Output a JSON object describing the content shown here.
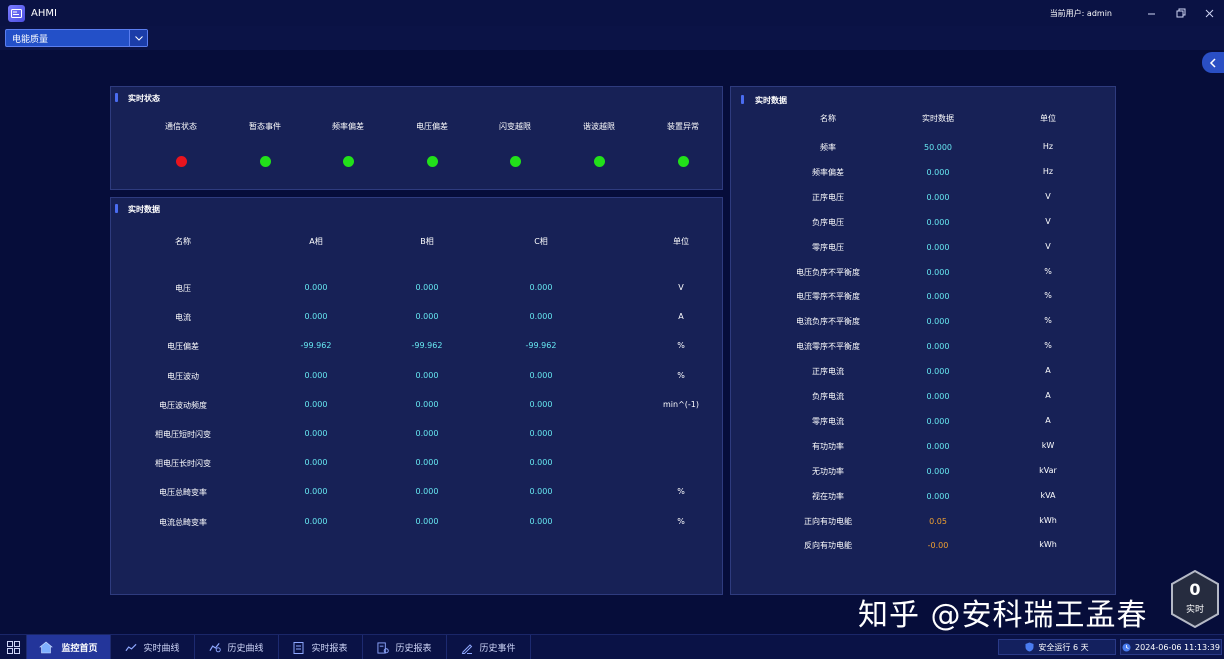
{
  "window": {
    "title": "AHMI",
    "user_label": "当前用户:  admin"
  },
  "toolbar": {
    "module_select": "电能质量"
  },
  "status_panel": {
    "title": "实时状态",
    "items": [
      {
        "label": "通信状态",
        "color": "#e8141e"
      },
      {
        "label": "暂态事件",
        "color": "#22e01a"
      },
      {
        "label": "频率偏差",
        "color": "#22e01a"
      },
      {
        "label": "电压偏差",
        "color": "#22e01a"
      },
      {
        "label": "闪变越限",
        "color": "#22e01a"
      },
      {
        "label": "谐波越限",
        "color": "#22e01a"
      },
      {
        "label": "装置异常",
        "color": "#22e01a"
      }
    ]
  },
  "phase_panel": {
    "title": "实时数据",
    "headers": [
      "名称",
      "A相",
      "B相",
      "C相",
      "单位"
    ],
    "rows": [
      {
        "name": "电压",
        "a": "0.000",
        "b": "0.000",
        "c": "0.000",
        "unit": "V"
      },
      {
        "name": "电流",
        "a": "0.000",
        "b": "0.000",
        "c": "0.000",
        "unit": "A"
      },
      {
        "name": "电压偏差",
        "a": "-99.962",
        "b": "-99.962",
        "c": "-99.962",
        "unit": "%"
      },
      {
        "name": "电压波动",
        "a": "0.000",
        "b": "0.000",
        "c": "0.000",
        "unit": "%"
      },
      {
        "name": "电压波动频度",
        "a": "0.000",
        "b": "0.000",
        "c": "0.000",
        "unit": "min^(-1)"
      },
      {
        "name": "相电压短时闪变",
        "a": "0.000",
        "b": "0.000",
        "c": "0.000",
        "unit": ""
      },
      {
        "name": "相电压长时闪变",
        "a": "0.000",
        "b": "0.000",
        "c": "0.000",
        "unit": ""
      },
      {
        "name": "电压总畸变率",
        "a": "0.000",
        "b": "0.000",
        "c": "0.000",
        "unit": "%"
      },
      {
        "name": "电流总畸变率",
        "a": "0.000",
        "b": "0.000",
        "c": "0.000",
        "unit": "%"
      }
    ]
  },
  "realtime_panel": {
    "title": "实时数据",
    "headers": [
      "名称",
      "实时数据",
      "单位"
    ],
    "rows": [
      {
        "name": "频率",
        "value": "50.000",
        "unit": "Hz"
      },
      {
        "name": "频率偏差",
        "value": "0.000",
        "unit": "Hz"
      },
      {
        "name": "正序电压",
        "value": "0.000",
        "unit": "V"
      },
      {
        "name": "负序电压",
        "value": "0.000",
        "unit": "V"
      },
      {
        "name": "零序电压",
        "value": "0.000",
        "unit": "V"
      },
      {
        "name": "电压负序不平衡度",
        "value": "0.000",
        "unit": "%"
      },
      {
        "name": "电压零序不平衡度",
        "value": "0.000",
        "unit": "%"
      },
      {
        "name": "电流负序不平衡度",
        "value": "0.000",
        "unit": "%"
      },
      {
        "name": "电流零序不平衡度",
        "value": "0.000",
        "unit": "%"
      },
      {
        "name": "正序电流",
        "value": "0.000",
        "unit": "A"
      },
      {
        "name": "负序电流",
        "value": "0.000",
        "unit": "A"
      },
      {
        "name": "零序电流",
        "value": "0.000",
        "unit": "A"
      },
      {
        "name": "有功功率",
        "value": "0.000",
        "unit": "kW"
      },
      {
        "name": "无功功率",
        "value": "0.000",
        "unit": "kVar"
      },
      {
        "name": "视在功率",
        "value": "0.000",
        "unit": "kVA"
      },
      {
        "name": "正向有功电能",
        "value": "0.05",
        "unit": "kWh",
        "highlight": true
      },
      {
        "name": "反向有功电能",
        "value": "-0.00",
        "unit": "kWh",
        "highlight": true
      }
    ]
  },
  "nav": {
    "items": [
      {
        "label": "监控首页",
        "icon": "home-icon",
        "active": true
      },
      {
        "label": "实时曲线",
        "icon": "trend-icon",
        "active": false
      },
      {
        "label": "历史曲线",
        "icon": "history-trend-icon",
        "active": false
      },
      {
        "label": "实时报表",
        "icon": "report-icon",
        "active": false
      },
      {
        "label": "历史报表",
        "icon": "history-report-icon",
        "active": false
      },
      {
        "label": "历史事件",
        "icon": "event-icon",
        "active": false
      }
    ]
  },
  "status_bar": {
    "safe_run": "安全运行 6 天",
    "datetime": "2024-06-06 11:13:39"
  },
  "badge": {
    "count": "0",
    "label": "实时"
  },
  "watermark": "知乎 @安科瑞王孟春"
}
